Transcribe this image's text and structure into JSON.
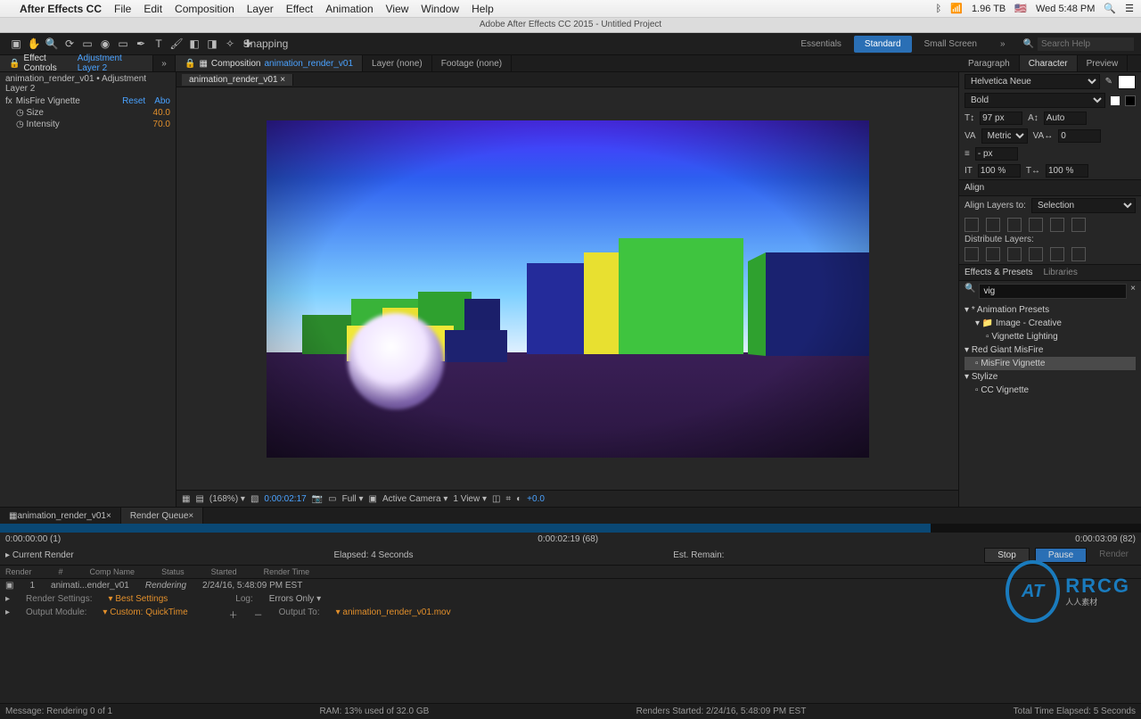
{
  "mac": {
    "apple": "",
    "app": "After Effects CC",
    "menus": [
      "File",
      "Edit",
      "Composition",
      "Layer",
      "Effect",
      "Animation",
      "View",
      "Window",
      "Help"
    ],
    "right": {
      "disk": "1.96 TB",
      "flag": "🇺🇸",
      "wifi": "📶",
      "bt": "ᛒ",
      "time": "Wed 5:48 PM"
    }
  },
  "titlebar": "Adobe After Effects CC 2015 - Untitled Project",
  "workspaces": {
    "items": [
      "Essentials",
      "Standard",
      "Small Screen"
    ],
    "active": 1,
    "search_ph": "Search Help"
  },
  "snapping": "Snapping",
  "panels_top": {
    "left": {
      "label": "Effect Controls",
      "target": "Adjustment Layer 2"
    },
    "center": [
      {
        "label": "Composition",
        "target": "animation_render_v01",
        "active": true
      },
      {
        "label": "Layer (none)"
      },
      {
        "label": "Footage (none)"
      }
    ],
    "right_tabs": [
      "Paragraph",
      "Character",
      "Preview"
    ]
  },
  "effects": {
    "breadcrumb": "animation_render_v01 • Adjustment Layer 2",
    "fx_name": "MisFire Vignette",
    "reset": "Reset",
    "about": "Abo",
    "params": [
      {
        "k": "Size",
        "v": "40.0"
      },
      {
        "k": "Intensity",
        "v": "70.0"
      }
    ]
  },
  "comp_tab": "animation_render_v01",
  "viewbar": {
    "zoom": "(168%)",
    "time": "0:00:02:17",
    "res": "Full",
    "camera": "Active Camera",
    "views": "1 View",
    "exp": "+0.0"
  },
  "character": {
    "font": "Helvetica Neue",
    "weight": "Bold",
    "size": "97 px",
    "leading": "Auto",
    "kerning": "Metrics",
    "tracking": "0",
    "stroke": "- px",
    "hscale": "100 %",
    "vscale": "100 %"
  },
  "align": {
    "head": "Align",
    "layers_to": "Align Layers to:",
    "target": "Selection",
    "dist": "Distribute Layers:"
  },
  "effects_presets": {
    "head": "Effects & Presets",
    "libs": "Libraries",
    "query": "vig",
    "tree": {
      "cat1": "* Animation Presets",
      "cat1a": "Image - Creative",
      "cat1a1": "Vignette Lighting",
      "cat2": "Red Giant MisFire",
      "cat2a": "MisFire Vignette",
      "cat3": "Stylize",
      "cat3a": "CC Vignette"
    }
  },
  "timeline": {
    "tabs": [
      "animation_render_v01",
      "Render Queue"
    ],
    "active": 1,
    "start": "0:00:00:00 (1)",
    "cur": "0:00:02:19 (68)",
    "end": "0:00:03:09 (82)"
  },
  "render": {
    "current": "Current Render",
    "elapsed": "Elapsed: 4 Seconds",
    "remain": "Est. Remain:",
    "stop": "Stop",
    "pause": "Pause",
    "render_btn": "Render",
    "cols": [
      "Render",
      "#",
      "Comp Name",
      "Status",
      "Started",
      "Render Time"
    ],
    "row": {
      "num": "1",
      "comp": "animati...ender_v01",
      "status": "Rendering",
      "started": "2/24/16, 5:48:09 PM EST"
    },
    "settings_lbl": "Render Settings:",
    "settings_val": "Best Settings",
    "log_lbl": "Log:",
    "log_val": "Errors Only",
    "output_lbl": "Output Module:",
    "output_val": "Custom: QuickTime",
    "output_to_lbl": "Output To:",
    "output_to_val": "animation_render_v01.mov"
  },
  "status": {
    "msg": "Message: Rendering 0 of 1",
    "ram": "RAM: 13% used of 32.0 GB",
    "started": "Renders Started: 2/24/16, 5:48:09 PM EST",
    "total": "Total Time Elapsed: 5 Seconds"
  },
  "watermark": {
    "brand": "RRCG",
    "sub": "人人素材"
  }
}
